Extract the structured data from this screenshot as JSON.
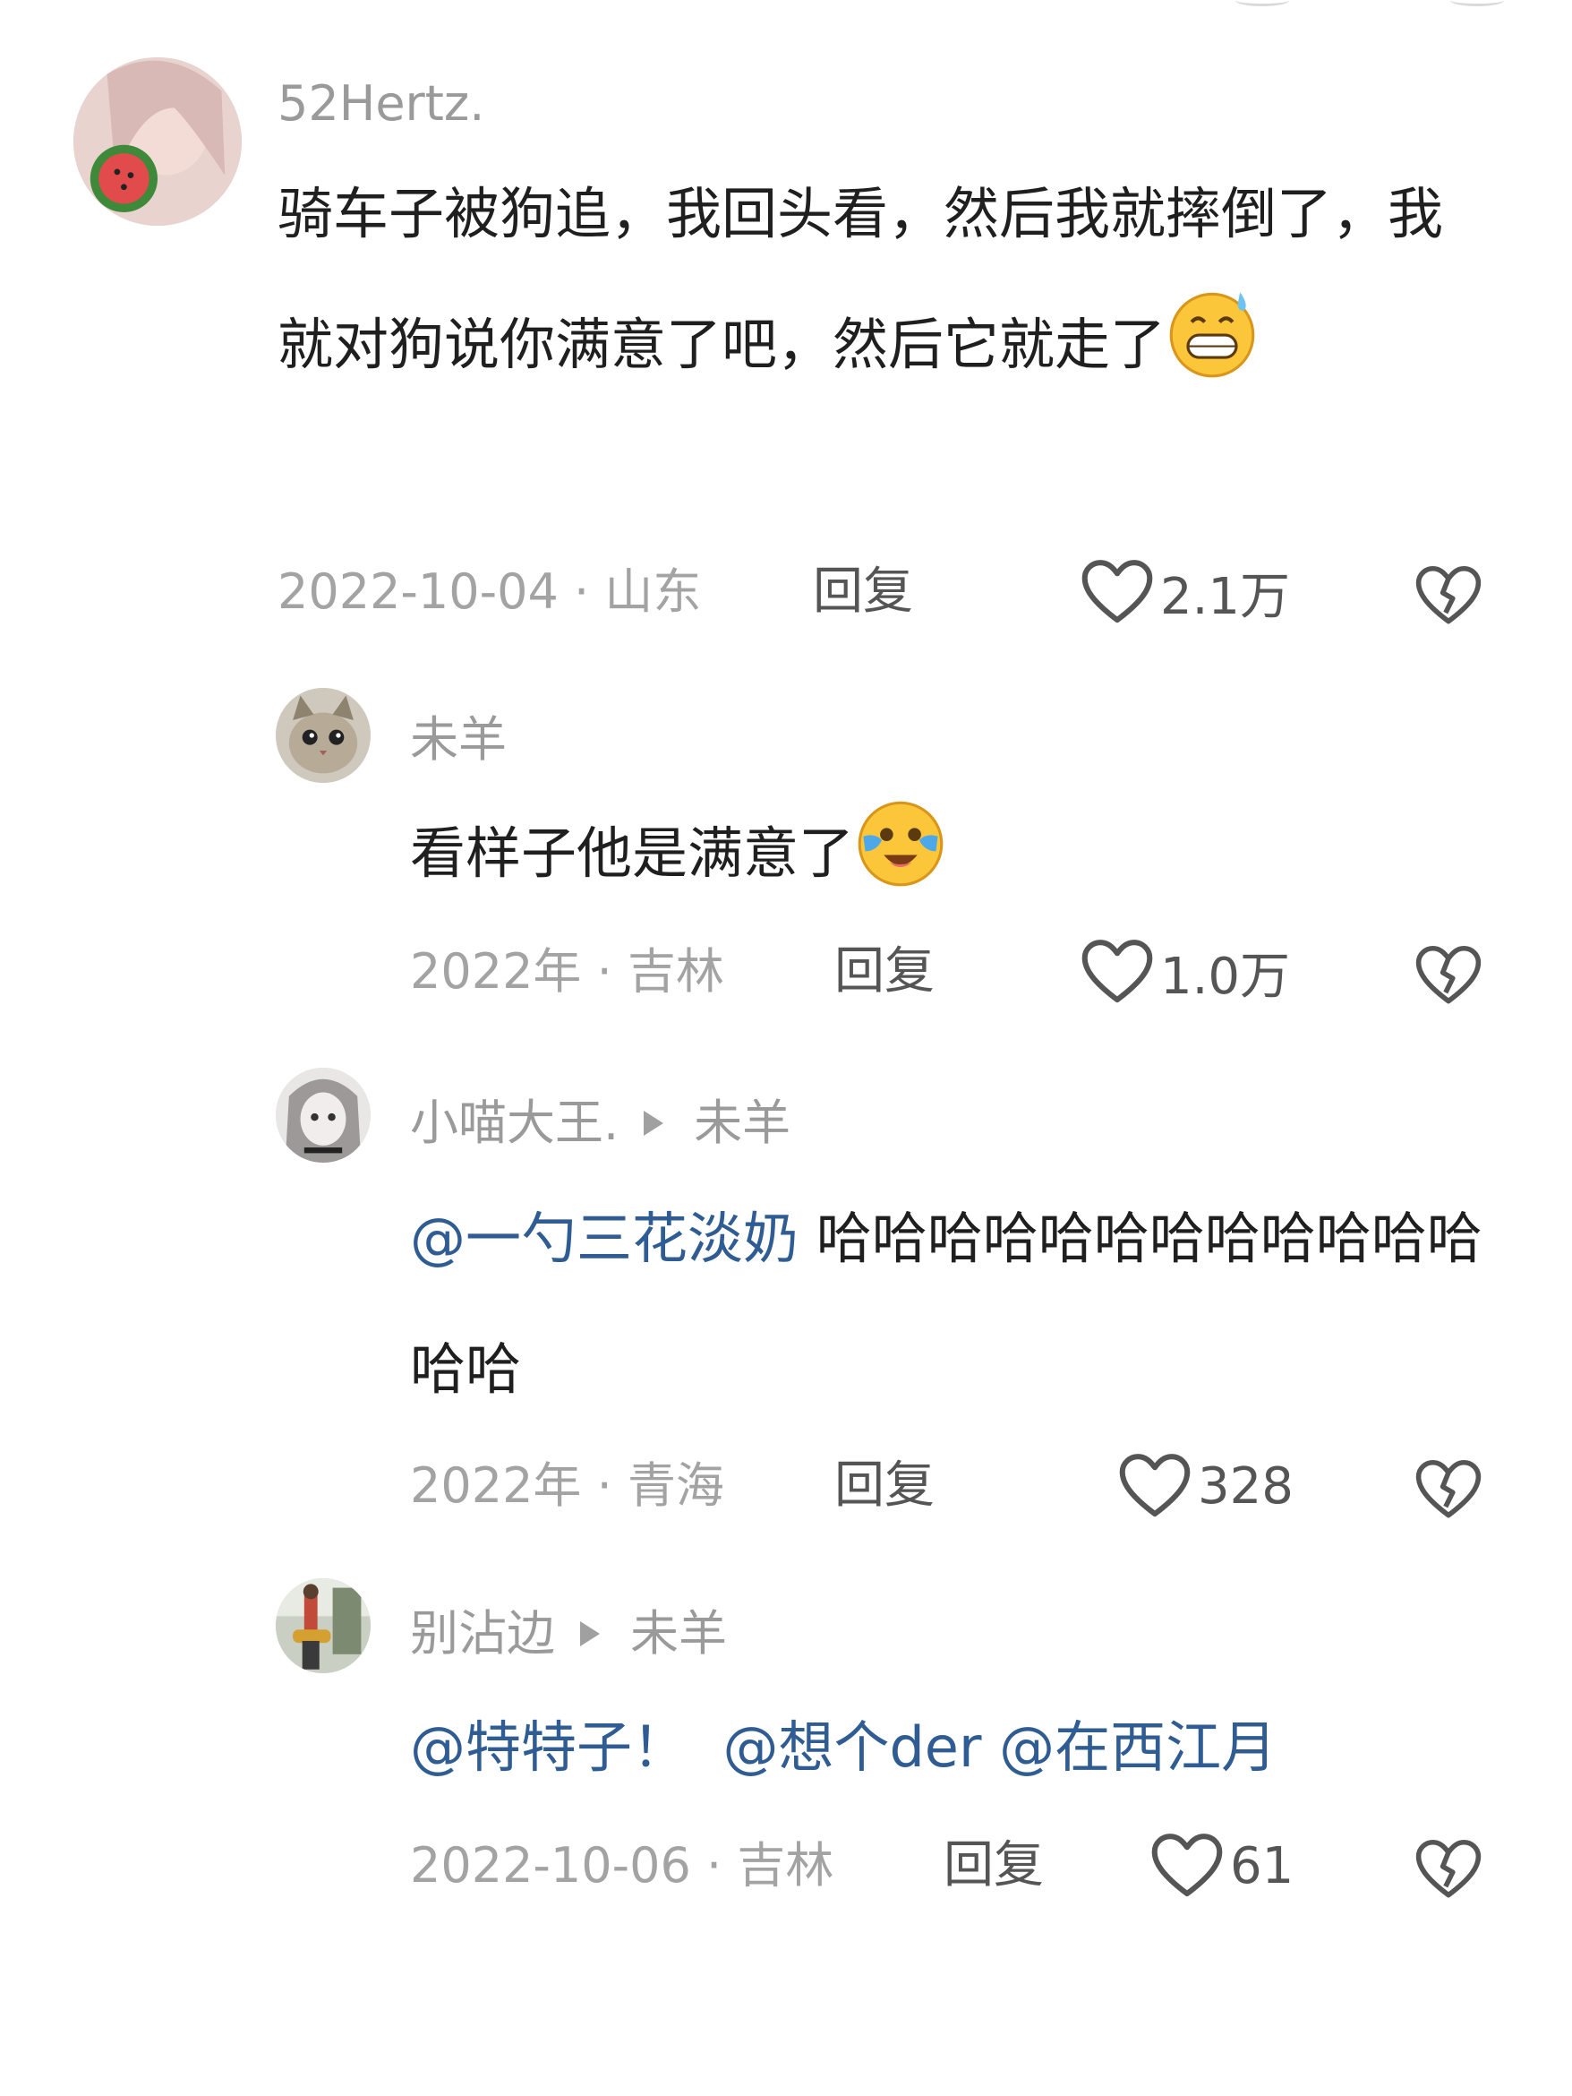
{
  "comments": [
    {
      "username": "52Hertz.",
      "text": "骑车子被狗追，我回头看，然后我就摔倒了，我就对狗说你满意了吧，然后它就走了",
      "emoji": "sweat-grin-emoji",
      "date": "2022-10-04",
      "location": "山东",
      "reply_label": "回复",
      "likes": "2.1万"
    },
    {
      "username": "未羊",
      "text": "看样子他是满意了",
      "emoji": "crying-laughing-emoji",
      "date": "2022年",
      "location": "吉林",
      "reply_label": "回复",
      "likes": "1.0万"
    },
    {
      "username": "小喵大王.",
      "reply_to": "未羊",
      "mention": "@一勺三花淡奶",
      "text": "哈哈哈哈哈哈哈哈哈哈哈哈哈哈",
      "date": "2022年",
      "location": "青海",
      "reply_label": "回复",
      "likes": "328"
    },
    {
      "username": "别沾边",
      "reply_to": "未羊",
      "mentions": [
        "@特特子！",
        "@想个der",
        "@在西江月"
      ],
      "date": "2022-10-06",
      "location": "吉林",
      "reply_label": "回复",
      "likes": "61"
    }
  ],
  "separator": " · "
}
